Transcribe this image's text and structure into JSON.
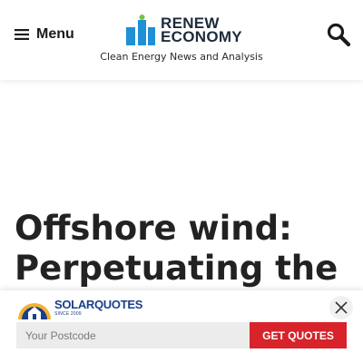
{
  "header": {
    "menu_label": "Menu",
    "logo_line1": "RENEW",
    "logo_line2": "ECONOMY",
    "tagline": "Clean Energy News and Analysis",
    "colors": {
      "logo_blue": "#1f8fd6",
      "logo_green": "#7ac143",
      "logo_text": "#1d2b3a"
    }
  },
  "article": {
    "headline_line1": "Offshore wind:",
    "headline_line2": "Perpetuating the"
  },
  "quote_bar": {
    "brand_name": "SOLARQUOTES",
    "brand_since": "SINCE 2009",
    "postcode_placeholder": "Your Postcode",
    "cta_label": "GET QUOTES",
    "colors": {
      "cta": "#d8232a",
      "brand_blue": "#1a3f8a"
    }
  },
  "icons": {
    "menu": "hamburger-icon",
    "search": "search-icon",
    "close": "close-icon"
  }
}
